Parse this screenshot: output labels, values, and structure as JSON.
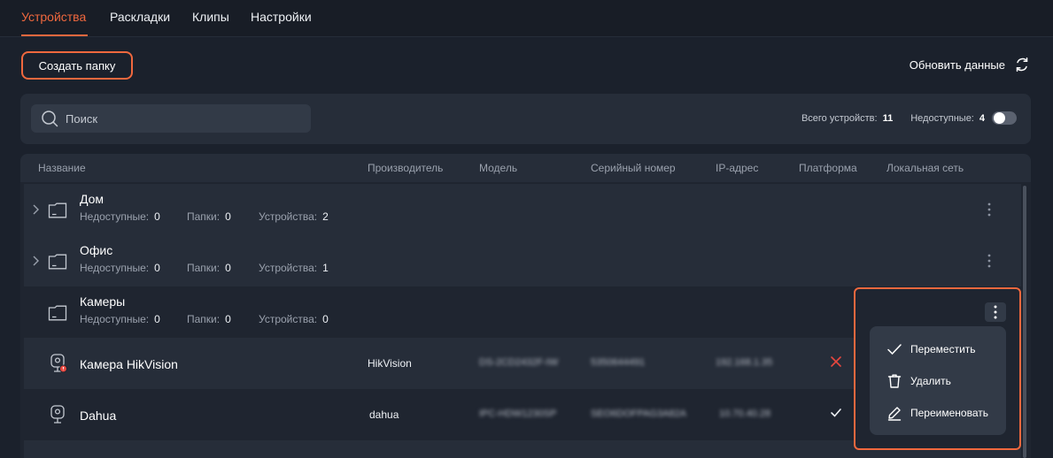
{
  "nav": {
    "tabs": [
      {
        "label": "Устройства",
        "active": true
      },
      {
        "label": "Раскладки",
        "active": false
      },
      {
        "label": "Клипы",
        "active": false
      },
      {
        "label": "Настройки",
        "active": false
      }
    ]
  },
  "toolbar": {
    "create_folder_label": "Создать папку",
    "refresh_label": "Обновить данные"
  },
  "search": {
    "placeholder": "Поиск",
    "total_label": "Всего устройств:",
    "total_value": "11",
    "unavailable_label": "Недоступные:",
    "unavailable_value": "4"
  },
  "table": {
    "columns": [
      "Название",
      "Производитель",
      "Модель",
      "Серийный номер",
      "IP-адрес",
      "Платформа",
      "Локальная сеть"
    ],
    "meta_labels": {
      "unavailable": "Недоступные:",
      "folders": "Папки:",
      "devices": "Устройства:"
    },
    "folders": [
      {
        "name": "Дом",
        "unavailable": "0",
        "folders": "0",
        "devices": "2"
      },
      {
        "name": "Офис",
        "unavailable": "0",
        "folders": "0",
        "devices": "1"
      },
      {
        "name": "Камеры",
        "unavailable": "0",
        "folders": "0",
        "devices": "0"
      }
    ],
    "devices": [
      {
        "name": "Камера HikVision",
        "vendor": "HikVision",
        "model": "DS-2CD2432F-IW",
        "serial": "5350644491",
        "ip": "192.168.1.35",
        "platform": "error"
      },
      {
        "name": "Dahua",
        "vendor": "dahua",
        "model": "IPC-HDW1230SP",
        "serial": "SEO6DOFPAG3A82A",
        "ip": "10.70.40.28",
        "platform": "ok"
      }
    ]
  },
  "menu": {
    "items": [
      {
        "label": "Переместить",
        "icon": "check-icon"
      },
      {
        "label": "Удалить",
        "icon": "trash-icon"
      },
      {
        "label": "Переименовать",
        "icon": "pencil-icon"
      }
    ]
  },
  "colors": {
    "accent": "#f0683e",
    "background": "#1b212c",
    "panel": "#262d39",
    "error": "#e8473f"
  }
}
